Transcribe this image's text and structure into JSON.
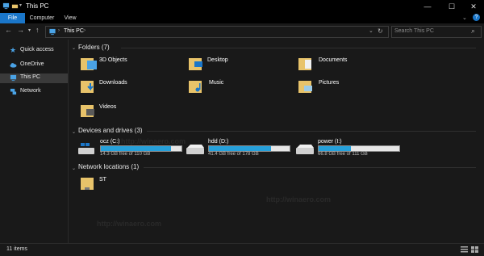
{
  "window": {
    "title": "This PC"
  },
  "ribbon": {
    "tabs": [
      {
        "label": "File"
      },
      {
        "label": "Computer"
      },
      {
        "label": "View"
      }
    ]
  },
  "nav": {
    "breadcrumb": [
      "This PC"
    ],
    "search_placeholder": "Search This PC"
  },
  "sidebar": {
    "items": [
      {
        "label": "Quick access",
        "icon": "star-icon"
      },
      {
        "label": "OneDrive",
        "icon": "cloud-icon"
      },
      {
        "label": "This PC",
        "icon": "computer-icon",
        "selected": true
      },
      {
        "label": "Network",
        "icon": "network-icon"
      }
    ]
  },
  "folders": {
    "header": "Folders (7)",
    "items": [
      {
        "label": "3D Objects"
      },
      {
        "label": "Desktop"
      },
      {
        "label": "Documents"
      },
      {
        "label": "Downloads"
      },
      {
        "label": "Music"
      },
      {
        "label": "Pictures"
      },
      {
        "label": "Videos"
      }
    ]
  },
  "drives": {
    "header": "Devices and drives (3)",
    "items": [
      {
        "label": "ocz (C:)",
        "free": "14.3 GB free of 110 GB",
        "used_fraction": 0.87
      },
      {
        "label": "hdd (D:)",
        "free": "41.4 GB free of 178 GB",
        "used_fraction": 0.77
      },
      {
        "label": "power (I:)",
        "free": "66.8 GB free of 111 GB",
        "used_fraction": 0.4
      }
    ]
  },
  "network": {
    "header": "Network locations (1)",
    "items": [
      {
        "label": "ST"
      }
    ]
  },
  "status": {
    "text": "11 items"
  },
  "watermark": "http://winaero.com",
  "colors": {
    "accent": "#1a76c9",
    "bar_fill": "#26a0da",
    "folder": "#e8c36a",
    "background": "#191919"
  }
}
